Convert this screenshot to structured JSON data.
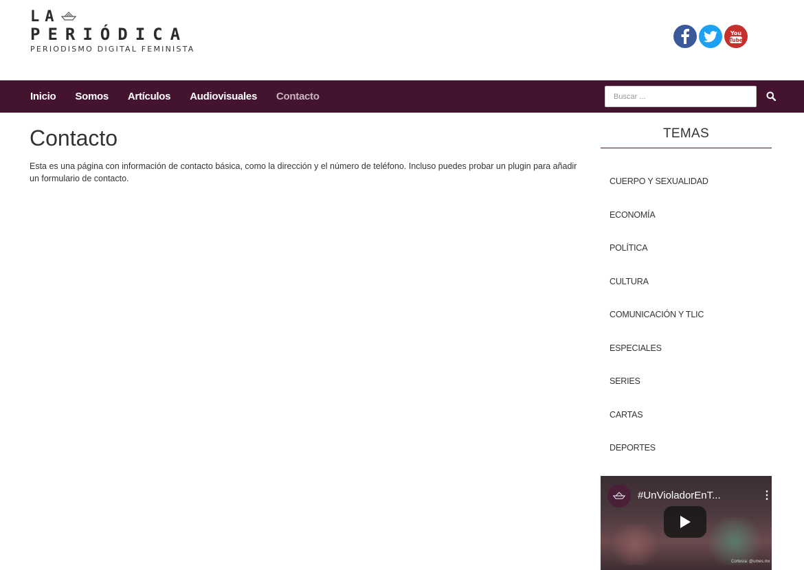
{
  "header": {
    "logo_line1": "LA",
    "logo_line2": "PERIÓDICA",
    "logo_tagline": "PERIODISMO DIGITAL FEMINISTA",
    "social": [
      {
        "name": "facebook",
        "icon": "facebook-icon",
        "color": "#3b5998"
      },
      {
        "name": "twitter",
        "icon": "twitter-icon",
        "color": "#1da1f2"
      },
      {
        "name": "youtube",
        "icon": "youtube-icon",
        "color": "#c4302b"
      }
    ]
  },
  "nav": {
    "items": [
      {
        "label": "Inicio"
      },
      {
        "label": "Somos"
      },
      {
        "label": "Artículos"
      },
      {
        "label": "Audiovisuales"
      },
      {
        "label": "Contacto",
        "active": true
      }
    ],
    "search_placeholder": "Buscar ...",
    "search_icon": "search-icon",
    "bar_color": "#43132f"
  },
  "main": {
    "title": "Contacto",
    "body": "Esta es una página con información de contacto básica, como la dirección y el número de teléfono. Incluso puedes probar un plugin para añadir un formulario de contacto."
  },
  "sidebar": {
    "title": "TEMAS",
    "topics": [
      {
        "label": "CUERPO Y SEXUALIDAD"
      },
      {
        "label": "ECONOMÍA"
      },
      {
        "label": "POLÍTICA"
      },
      {
        "label": "CULTURA"
      },
      {
        "label": "COMUNICACIÓN Y TLIC"
      },
      {
        "label": "ESPECIALES"
      },
      {
        "label": "SERIES"
      },
      {
        "label": "CARTAS"
      },
      {
        "label": "DEPORTES"
      }
    ],
    "video": {
      "title": "#UnVioladorEnT...",
      "credit": "Cortesía: @umes.mx",
      "play_icon": "play-icon",
      "menu_icon": "more-vertical-icon"
    }
  }
}
